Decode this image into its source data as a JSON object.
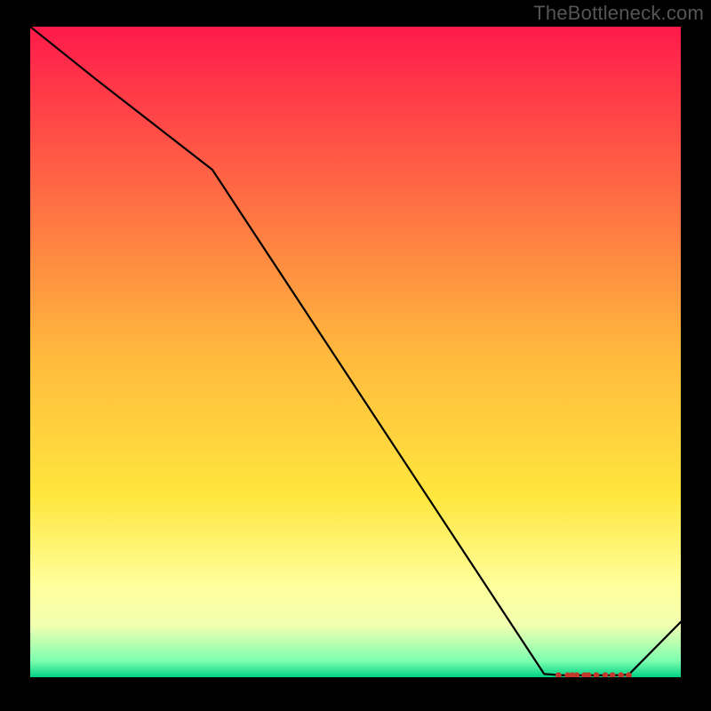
{
  "watermark": "TheBottleneck.com",
  "chart_data": {
    "type": "line",
    "title": "",
    "xlabel": "",
    "ylabel": "",
    "x": [
      0.0,
      0.1,
      0.28,
      0.79,
      0.82,
      0.84,
      0.86,
      0.88,
      0.9,
      0.92,
      1.0
    ],
    "values": [
      1.0,
      0.92,
      0.78,
      0.005,
      0.003,
      0.003,
      0.003,
      0.003,
      0.003,
      0.004,
      0.085
    ],
    "markers_x": [
      0.812,
      0.826,
      0.833,
      0.84,
      0.852,
      0.858,
      0.87,
      0.884,
      0.895,
      0.908,
      0.92
    ],
    "xlim": [
      0,
      1
    ],
    "ylim": [
      0,
      1
    ],
    "gradient_stops": [
      {
        "offset": 0.0,
        "color": "#ff1a4b"
      },
      {
        "offset": 0.5,
        "color": "#ffb83d"
      },
      {
        "offset": 0.72,
        "color": "#ffe63d"
      },
      {
        "offset": 0.86,
        "color": "#ffff9c"
      },
      {
        "offset": 0.92,
        "color": "#f2ffb0"
      },
      {
        "offset": 0.975,
        "color": "#7dffb0"
      },
      {
        "offset": 1.0,
        "color": "#00d184"
      }
    ],
    "line_color": "#000000",
    "marker_color": "#c0392b"
  }
}
